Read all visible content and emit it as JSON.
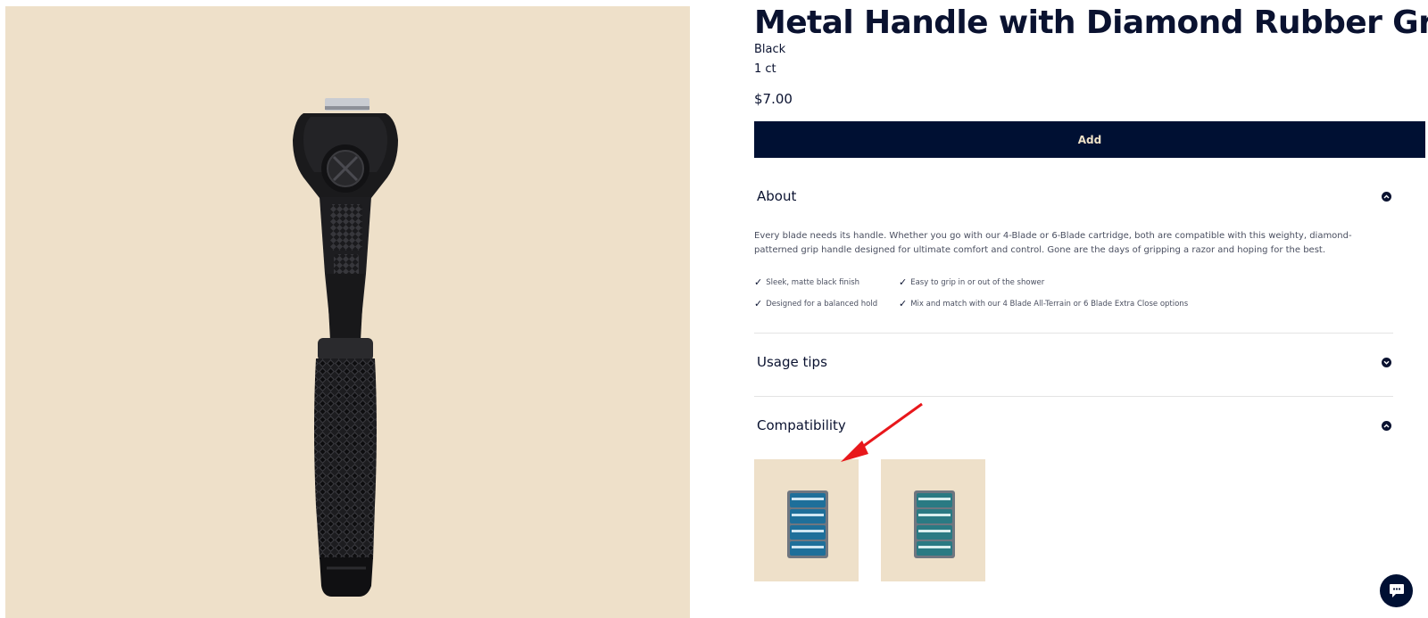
{
  "product": {
    "title": "Metal Handle with Diamond Rubber Grip",
    "variant": "Black",
    "count": "1 ct",
    "price": "$7.00",
    "image_icon": "razor-handle-image"
  },
  "actions": {
    "add_label": "Add"
  },
  "accordion": {
    "about": {
      "label": "About",
      "state_icon": "chevron-up-icon",
      "description": "Every blade needs its handle. Whether you go with our 4-Blade or 6-Blade cartridge, both are compatible with this weighty, diamond-patterned grip handle designed for ultimate comfort and control. Gone are the days of gripping a razor and hoping for the best.",
      "features": [
        "Sleek, matte black finish",
        "Easy to grip in or out of the shower",
        "Designed for a balanced hold",
        "Mix and match with our 4 Blade All-Terrain or 6 Blade Extra Close options"
      ]
    },
    "usage": {
      "label": "Usage tips",
      "state_icon": "chevron-down-icon"
    },
    "compatibility": {
      "label": "Compatibility",
      "state_icon": "chevron-up-icon",
      "items": [
        {
          "icon": "cartridge-pack-image"
        },
        {
          "icon": "cartridge-pack-image"
        }
      ]
    }
  },
  "colors": {
    "navy": "#001033",
    "beige": "#eee0c9",
    "text_gray": "#4a4f60",
    "annotation_red": "#e8171b"
  },
  "chat": {
    "icon": "chat-bubble-icon"
  }
}
